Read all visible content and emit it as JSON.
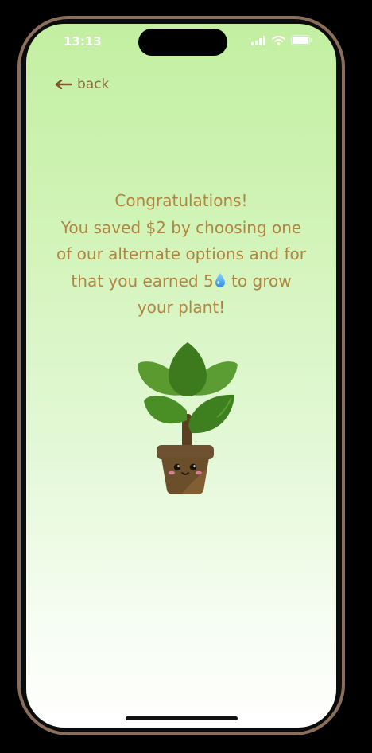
{
  "status_bar": {
    "time": "13:13"
  },
  "nav": {
    "back_label": "back"
  },
  "message": {
    "line1": "Congratulations!",
    "line2": "You saved $2 by choosing one",
    "line3": "of our alternate options and for",
    "line4_pre": "that you earned 5",
    "line4_post": " to grow",
    "line5": "your plant!"
  },
  "icons": {
    "water_drop": "water-drop-icon",
    "back": "left-arrow-icon",
    "plant": "potted-plant-illustration"
  },
  "colors": {
    "text": "#b3843f",
    "back": "#8b6a3c",
    "leaf_light": "#5a9a2e",
    "leaf_dark": "#3d7a1d",
    "pot": "#6b4e2a"
  }
}
